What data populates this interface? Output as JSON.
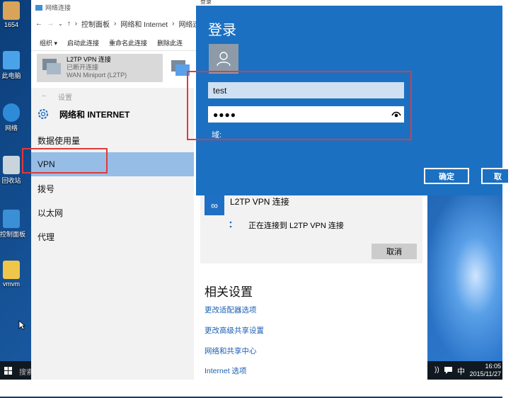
{
  "desktop": {
    "icons": [
      {
        "label": "1654",
        "color": "#d9a45a",
        "icon": "user-folder-icon"
      },
      {
        "label": "此电脑",
        "color": "#4aa3e8",
        "icon": "computer-icon"
      },
      {
        "label": "网络",
        "color": "#2e8bd8",
        "icon": "network-icon"
      },
      {
        "label": "回收站",
        "color": "#c9d4dd",
        "icon": "recycle-bin-icon"
      },
      {
        "label": "控制面板",
        "color": "#3b8fd6",
        "icon": "control-panel-icon"
      },
      {
        "label": "vmvm",
        "color": "#f0c64a",
        "icon": "folder-icon"
      }
    ]
  },
  "taskbar": {
    "search_text": "搜索",
    "ime": "中",
    "time": "16:05",
    "date": "2015/11/27"
  },
  "explorer": {
    "title": "网络连接",
    "breadcrumb": [
      "控制面板",
      "网络和 Internet",
      "网络连"
    ],
    "toolbar": [
      "组织 ▾",
      "启动此连接",
      "重命名此连接",
      "删除此连"
    ],
    "connection": {
      "name": "L2TP VPN 连接",
      "status": "已断开连接",
      "device": "WAN Miniport (L2TP)"
    }
  },
  "settings": {
    "back_label": "设置",
    "header": "网络和 INTERNET",
    "nav": [
      "数据使用量",
      "VPN",
      "拨号",
      "以太网",
      "代理"
    ],
    "active_nav": "VPN",
    "vpn": {
      "name": "L2TP VPN 连接",
      "status": "正在连接到 L2TP VPN 连接",
      "cancel_label": "取消"
    },
    "related": {
      "title": "相关设置",
      "links": [
        "更改适配器选项",
        "更改高级共享设置",
        "网络和共享中心",
        "Internet 选项"
      ]
    }
  },
  "dialog": {
    "window_title": "登录",
    "title": "登录",
    "username": "test",
    "password_mask": "●●●●",
    "domain_label": "域:",
    "ok_label": "确定",
    "cancel_label": "取"
  },
  "colors": {
    "accent": "#1c70c1",
    "highlight": "#e03a3a",
    "nav_active": "#96bde6"
  }
}
